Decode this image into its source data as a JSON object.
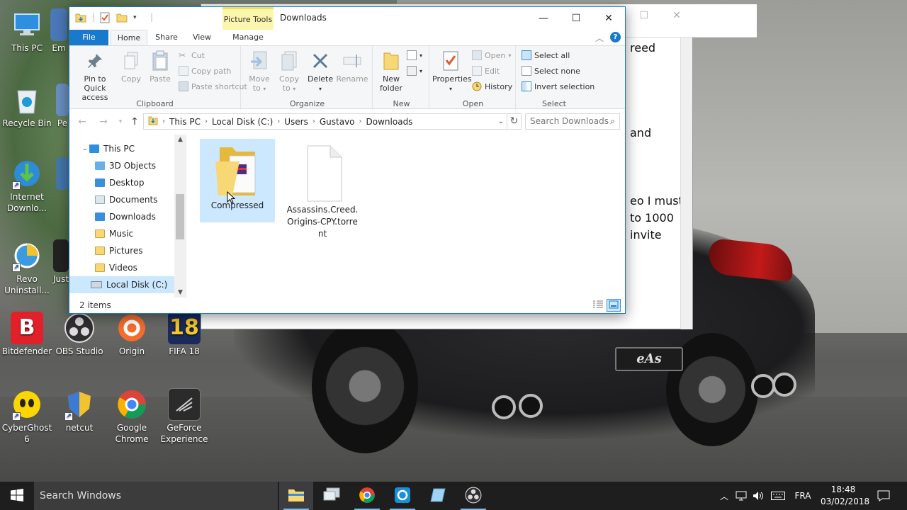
{
  "desktop": {
    "icons": [
      {
        "label": "This PC"
      },
      {
        "label": "Recycle Bin"
      },
      {
        "label": "Internet Downlo..."
      },
      {
        "label": "Revo Uninstall..."
      },
      {
        "label": "Bitdefender"
      },
      {
        "label": "OBS Studio"
      },
      {
        "label": "Origin"
      },
      {
        "label": "FIFA 18"
      },
      {
        "label": "CyberGhost 6"
      },
      {
        "label": "netcut"
      },
      {
        "label": "Google Chrome"
      },
      {
        "label": "GeForce Experience"
      }
    ],
    "partial_labels": [
      "Em",
      "Pe",
      "Just"
    ],
    "fifa_badge": "18",
    "bitdefender_badge": "B",
    "car_plate": "eAs"
  },
  "background_window": {
    "lines": [
      "reed",
      "and",
      "eo I must",
      "to 1000",
      "invite"
    ]
  },
  "explorer": {
    "title": "Downloads",
    "contextual_tab_group": "Picture Tools",
    "window_controls": {
      "minimize": "—",
      "maximize": "☐",
      "close": "✕"
    },
    "tabs": {
      "file": "File",
      "home": "Home",
      "share": "Share",
      "view": "View",
      "manage": "Manage"
    },
    "ribbon": {
      "clipboard": {
        "label": "Clipboard",
        "pin": "Pin to Quick access",
        "copy": "Copy",
        "paste": "Paste",
        "cut": "Cut",
        "copy_path": "Copy path",
        "paste_shortcut": "Paste shortcut"
      },
      "organize": {
        "label": "Organize",
        "move_to": "Move to",
        "copy_to": "Copy to",
        "delete": "Delete",
        "rename": "Rename"
      },
      "new": {
        "label": "New",
        "new_folder": "New folder"
      },
      "open": {
        "label": "Open",
        "properties": "Properties",
        "open": "Open",
        "edit": "Edit",
        "history": "History"
      },
      "select": {
        "label": "Select",
        "select_all": "Select all",
        "select_none": "Select none",
        "invert_selection": "Invert selection"
      }
    },
    "address": {
      "path": [
        "This PC",
        "Local Disk (C:)",
        "Users",
        "Gustavo",
        "Downloads"
      ],
      "search_placeholder": "Search Downloads"
    },
    "nav_pane": {
      "root": "This PC",
      "items": [
        "3D Objects",
        "Desktop",
        "Documents",
        "Downloads",
        "Music",
        "Pictures",
        "Videos",
        "Local Disk (C:)"
      ],
      "selected": "Local Disk (C:)"
    },
    "files": [
      {
        "name": "Compressed",
        "kind": "folder",
        "selected": true
      },
      {
        "name_lines": [
          "Assassins.Creed.",
          "Origins-CPY.torre",
          "nt"
        ],
        "kind": "file",
        "selected": false
      }
    ],
    "status": {
      "item_count": "2 items"
    }
  },
  "taskbar": {
    "search_placeholder": "Search Windows",
    "apps": [
      "file-explorer",
      "remote-desktop",
      "google-chrome",
      "uplay",
      "notepad",
      "obs-studio"
    ],
    "active_app": "file-explorer",
    "language": "FRA",
    "time": "18:48",
    "date": "03/02/2018"
  },
  "colors": {
    "accent": "#1979ca",
    "selection": "#cce8ff",
    "contextual_tab": "#faf6ac",
    "folder": "#f8d775",
    "taskbar": "#1e1e1f"
  }
}
